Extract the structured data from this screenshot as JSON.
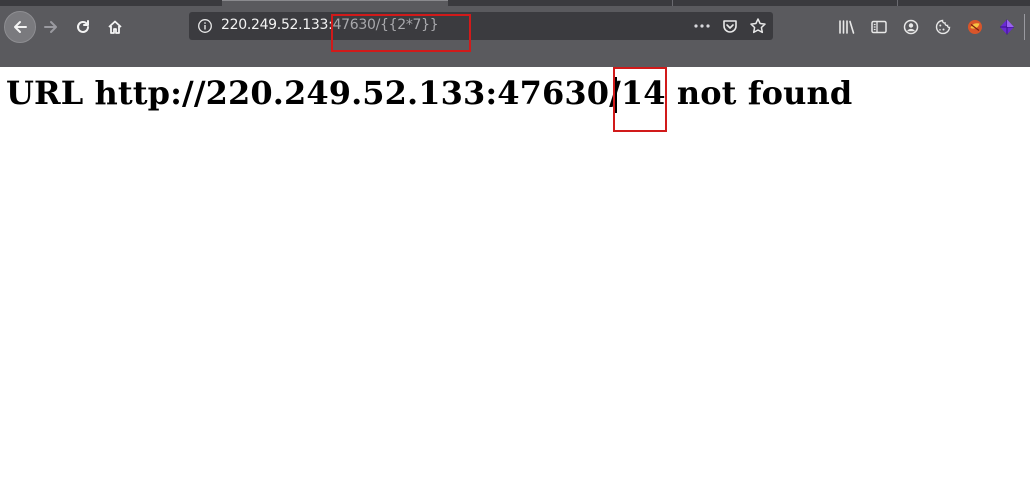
{
  "browser": {
    "url": {
      "host": "220.249.52.133:",
      "rest": "47630/{{2*7}}"
    },
    "icons": {
      "back": "back-arrow-icon",
      "forward": "forward-arrow-icon",
      "reload": "reload-icon",
      "home": "home-icon",
      "site_info": "info-icon",
      "page_actions": "ellipsis-icon",
      "pocket": "pocket-icon",
      "bookmark": "star-icon",
      "library": "library-icon",
      "sidebar": "sidebar-icon",
      "account": "account-icon",
      "cookie": "cookie-icon",
      "ext1": "extension-icon",
      "ext2": "extension-gem-icon"
    }
  },
  "page": {
    "heading": "URL http://220.249.52.133:47630/14 not found"
  },
  "colors": {
    "chrome": "#5a5a5e",
    "urlbar": "#3b3b3f",
    "annotation": "#d11a1a"
  }
}
